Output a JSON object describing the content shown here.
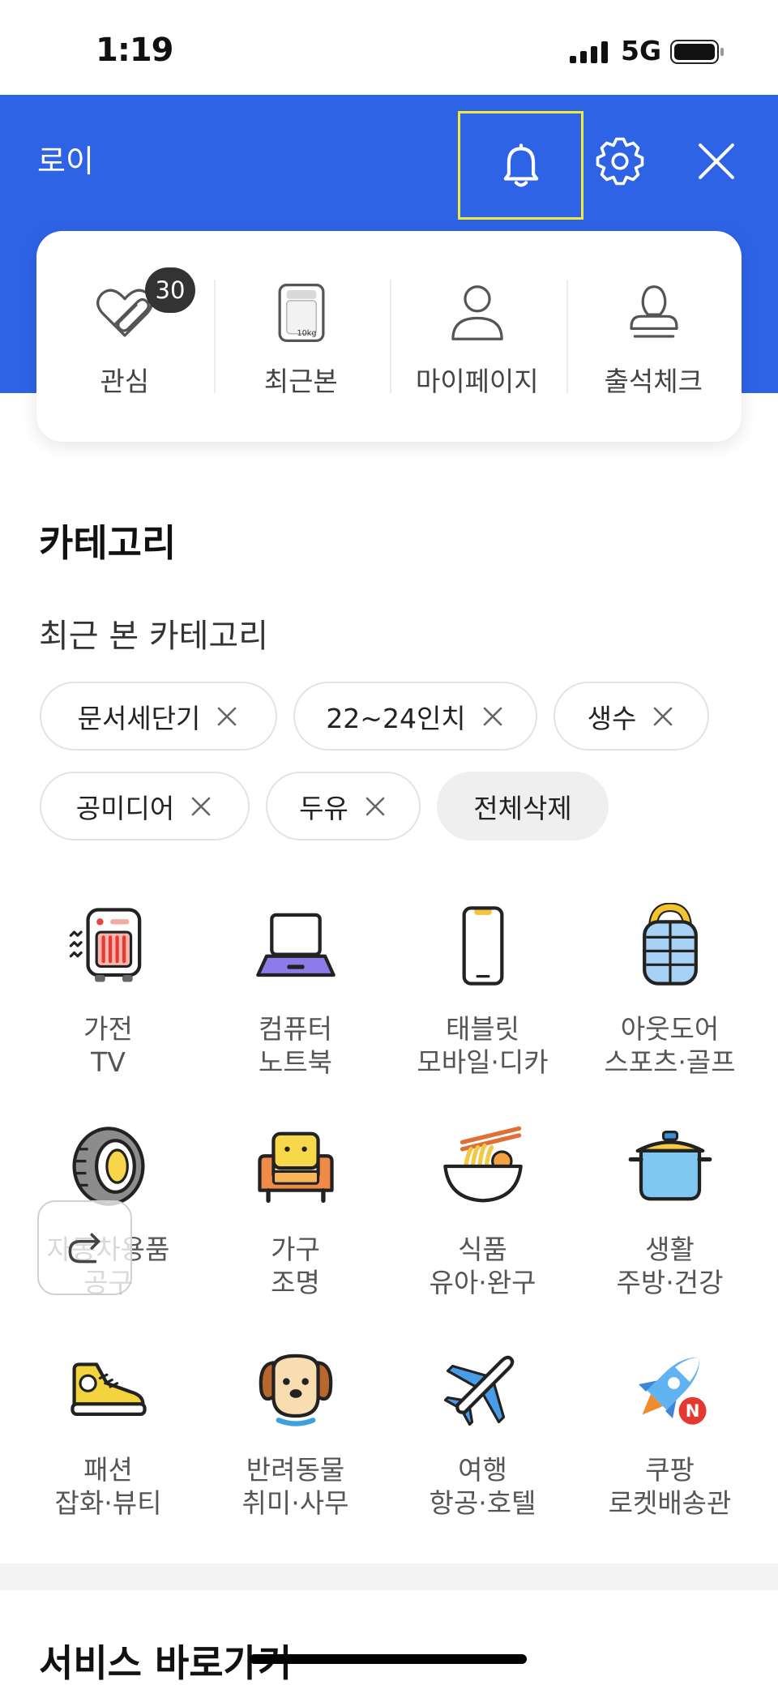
{
  "status_bar": {
    "time": "1:19",
    "network": "5G",
    "signal_icon": "signal-bars-icon",
    "battery_icon": "battery-icon"
  },
  "header": {
    "user_name": "로이",
    "icons": [
      "bell-icon",
      "gear-icon",
      "close-icon"
    ]
  },
  "quick_menu": {
    "items": [
      {
        "label": "관심",
        "icon": "heart-clip-icon",
        "badge": "30"
      },
      {
        "label": "최근본",
        "icon": "washer-icon",
        "icon_text": "10kg"
      },
      {
        "label": "마이페이지",
        "icon": "person-icon"
      },
      {
        "label": "출석체크",
        "icon": "stamp-icon"
      }
    ]
  },
  "category": {
    "title": "카테고리",
    "recent_title": "최근 본 카테고리",
    "recent_chips": [
      "문서세단기",
      "22~24인치",
      "생수",
      "공미디어",
      "두유"
    ],
    "clear_all_label": "전체삭제",
    "items": [
      {
        "line1": "가전",
        "line2": "TV",
        "icon": "heater-icon"
      },
      {
        "line1": "컴퓨터",
        "line2": "노트북",
        "icon": "laptop-icon"
      },
      {
        "line1": "태블릿",
        "line2": "모바일·디카",
        "icon": "smartphone-icon"
      },
      {
        "line1": "아웃도어",
        "line2": "스포츠·골프",
        "icon": "puffer-jacket-icon"
      },
      {
        "line1": "자동차용품",
        "line2": "공구",
        "icon": "tire-icon"
      },
      {
        "line1": "가구",
        "line2": "조명",
        "icon": "armchair-icon"
      },
      {
        "line1": "식품",
        "line2": "유아·완구",
        "icon": "noodle-bowl-icon"
      },
      {
        "line1": "생활",
        "line2": "주방·건강",
        "icon": "pot-icon"
      },
      {
        "line1": "패션",
        "line2": "잡화·뷰티",
        "icon": "sneaker-icon"
      },
      {
        "line1": "반려동물",
        "line2": "취미·사무",
        "icon": "dog-icon"
      },
      {
        "line1": "여행",
        "line2": "항공·호텔",
        "icon": "airplane-icon"
      },
      {
        "line1": "쿠팡",
        "line2": "로켓배송관",
        "icon": "rocket-icon",
        "icon_badge": "N"
      }
    ]
  },
  "floating_button": {
    "icon": "redo-arrow-icon"
  },
  "services": {
    "title": "서비스 바로가기"
  },
  "colors": {
    "header_bg": "#2F63E6",
    "highlight_border": "#F2E83A",
    "badge_bg": "#333333",
    "chip_border": "#E3E3E3",
    "clear_all_bg": "#EFEFEF",
    "section_divider": "#F4F4F4"
  }
}
